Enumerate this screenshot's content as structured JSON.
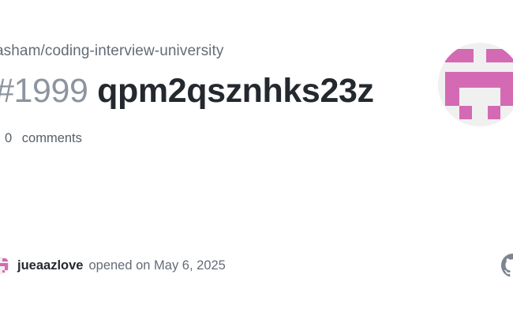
{
  "repo": {
    "path": "asham/coding-interview-university"
  },
  "issue": {
    "number": "#1999",
    "title": "qpm2qsznhks23z"
  },
  "comments": {
    "count": "0",
    "label": "comments"
  },
  "author": {
    "username": "jueaazlove",
    "opened_text": "opened on May 6, 2025"
  },
  "icons": {
    "avatar": "identicon-avatar",
    "brand": "github-mark-icon"
  },
  "colors": {
    "identicon": "#d46ab3",
    "identicon_bg": "#f0f0f0",
    "title": "#24292f",
    "muted": "#636c76",
    "number": "#8c959f",
    "github_mark": "#7d8590"
  }
}
